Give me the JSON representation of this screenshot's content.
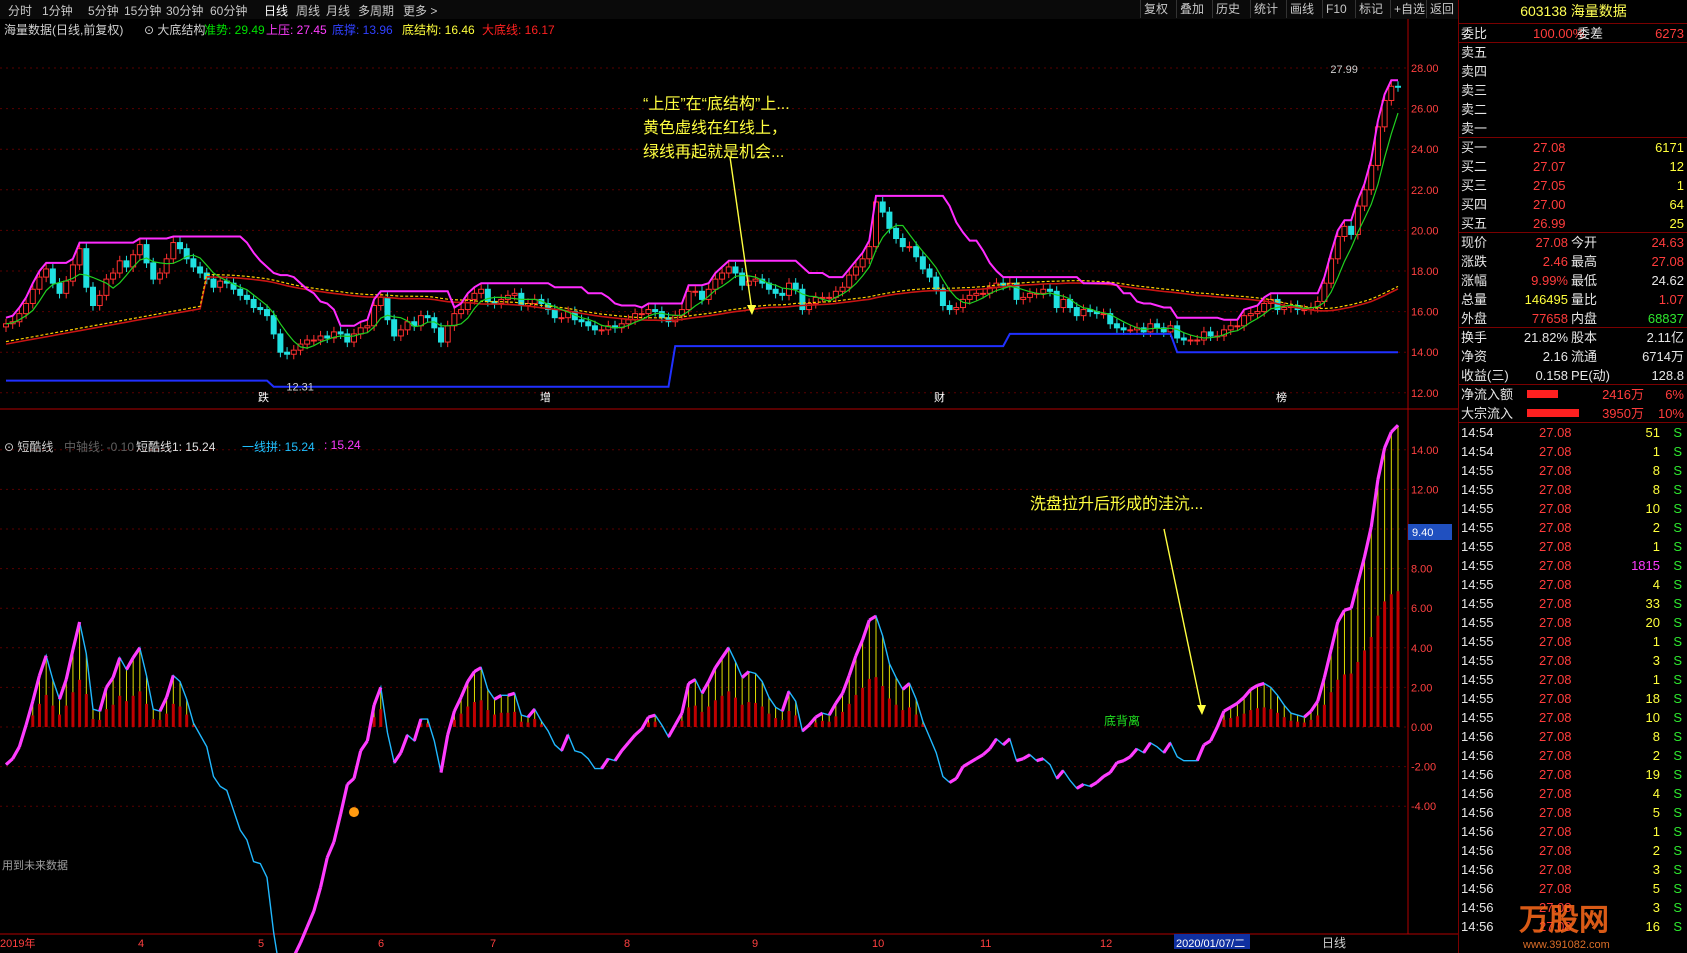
{
  "periods": [
    "分时",
    "1分钟",
    "5分钟",
    "15分钟",
    "30分钟",
    "60分钟",
    "日线",
    "周线",
    "月线",
    "多周期",
    "更多 >"
  ],
  "toolbar": [
    "复权",
    "叠加",
    "历史",
    "统计",
    "画线",
    "F10",
    "标记",
    "+自选",
    "返回"
  ],
  "upper": {
    "stock": "海量数据(日线,前复权)",
    "indicator": "大底结构",
    "vals": [
      {
        "t": "准势: 29.49",
        "c": "#00e000"
      },
      {
        "t": "上压: 27.45",
        "c": "#ff3cff"
      },
      {
        "t": "底撑: 13.96",
        "c": "#3040ff"
      },
      {
        "t": "底结构: 16.46",
        "c": "#ffff3c"
      },
      {
        "t": "大底线: 16.17",
        "c": "#ff2020"
      }
    ],
    "annotation": [
      "“上压”在“底结构”上...",
      "黄色虚线在红线上，",
      "绿线再起就是机会..."
    ],
    "high_label": "27.99",
    "low_label": "12.31",
    "markers": [
      "跌",
      "增",
      "财",
      "榜"
    ],
    "yaxis": [
      "28.00",
      "26.00",
      "24.00",
      "22.00",
      "20.00",
      "18.00",
      "16.00",
      "14.00",
      "12.00"
    ]
  },
  "lower": {
    "indicator": "短酷线",
    "vals": [
      {
        "t": "中轴线: -0.10",
        "c": "#606060"
      },
      {
        "t": "短酷线1: 15.24",
        "c": "#e0e0e0"
      },
      {
        "t": "一线拼: 15.24",
        "c": "#20c0ff"
      },
      {
        "t": ": 15.24",
        "c": "#ff3cff"
      }
    ],
    "annotation": "洗盘拉升后形成的洼沆...",
    "bottom_label": "底背离",
    "cursor_val": "9.40",
    "footnote": "用到未来数据",
    "yaxis": [
      "14.00",
      "12.00",
      "10.00",
      "8.00",
      "6.00",
      "4.00",
      "2.00",
      "0.00",
      "-2.00",
      "-4.00"
    ]
  },
  "xaxis": [
    "2019年",
    "4",
    "5",
    "6",
    "7",
    "8",
    "9",
    "10",
    "11",
    "12",
    "2020/01/07/二"
  ],
  "period_label": "日线",
  "chart_data": {
    "type": "candlestick",
    "title": "海量数据(日线,前复权)",
    "ylim": [
      11.5,
      29.5
    ],
    "close": [
      15.4,
      15.5,
      15.9,
      16.4,
      17.1,
      17.7,
      18.1,
      17.4,
      16.9,
      17.5,
      18.3,
      19.1,
      17.2,
      16.3,
      16.8,
      17.6,
      17.9,
      18.5,
      18.2,
      18.8,
      19.3,
      18.4,
      17.6,
      17.9,
      18.6,
      19.4,
      19.1,
      18.6,
      18.2,
      17.9,
      17.6,
      17.2,
      17.5,
      17.4,
      17.1,
      16.8,
      16.6,
      16.2,
      16.1,
      15.8,
      14.9,
      14.0,
      13.9,
      14.1,
      14.4,
      14.6,
      14.6,
      14.8,
      14.7,
      15.0,
      14.9,
      14.5,
      14.9,
      15.2,
      15.3,
      16.3,
      16.7,
      15.6,
      14.8,
      15.1,
      15.5,
      15.3,
      15.8,
      15.7,
      15.2,
      14.5,
      15.3,
      15.9,
      16.1,
      16.6,
      16.9,
      17.1,
      16.5,
      16.4,
      16.6,
      16.8,
      16.9,
      16.3,
      16.4,
      16.6,
      16.4,
      16.1,
      15.7,
      15.7,
      16.0,
      15.6,
      15.5,
      15.3,
      15.1,
      15.1,
      15.3,
      15.2,
      15.4,
      15.6,
      15.9,
      15.9,
      16.1,
      16.0,
      15.7,
      15.5,
      15.8,
      16.1,
      17.0,
      17.0,
      16.6,
      17.1,
      17.6,
      17.9,
      18.2,
      17.9,
      17.3,
      17.5,
      17.6,
      17.4,
      17.1,
      16.9,
      16.8,
      17.4,
      17.1,
      16.1,
      16.4,
      16.7,
      16.7,
      16.7,
      17.0,
      17.2,
      17.8,
      18.2,
      18.6,
      19.2,
      21.4,
      20.9,
      20.1,
      19.6,
      19.2,
      19.2,
      18.7,
      18.1,
      17.7,
      17.1,
      16.3,
      16.1,
      16.2,
      16.6,
      16.8,
      16.9,
      16.9,
      17.2,
      17.4,
      17.3,
      17.4,
      16.6,
      16.7,
      16.9,
      16.9,
      17.1,
      17.0,
      16.2,
      16.6,
      16.2,
      15.8,
      16.1,
      16.0,
      15.9,
      15.9,
      15.4,
      15.2,
      15.1,
      15.1,
      15.2,
      15.0,
      15.4,
      15.2,
      15.0,
      15.3,
      14.7,
      14.6,
      14.6,
      14.6,
      15.0,
      14.8,
      14.8,
      15.1,
      15.3,
      15.3,
      15.8,
      15.9,
      16.0,
      16.4,
      16.6,
      16.1,
      16.2,
      16.3,
      16.1,
      16.1,
      16.2,
      16.5,
      17.4,
      18.6,
      19.7,
      20.2,
      19.8,
      21.2,
      22.0,
      23.2,
      25.1,
      26.4,
      27.1,
      27.08
    ],
    "lower_values": [
      -1.9,
      -1.6,
      -1.0,
      0.1,
      1.3,
      2.6,
      3.6,
      2.4,
      1.4,
      2.4,
      3.9,
      5.3,
      3.7,
      0.9,
      0.8,
      2.0,
      2.5,
      3.5,
      2.9,
      3.5,
      4.0,
      2.6,
      0.9,
      0.8,
      1.5,
      2.6,
      2.3,
      1.4,
      0.2,
      -0.4,
      -1.0,
      -2.5,
      -3.0,
      -3.2,
      -4.2,
      -5.2,
      -5.7,
      -6.8,
      -6.9,
      -7.6,
      -10.4,
      -12.5,
      -12.9,
      -11.6,
      -10.9,
      -10.1,
      -9.3,
      -8.1,
      -6.6,
      -5.8,
      -4.4,
      -2.9,
      -2.6,
      -1.2,
      -0.7,
      1.1,
      2.0,
      -0.3,
      -1.8,
      -1.3,
      -0.4,
      -0.7,
      0.4,
      0.4,
      -0.7,
      -2.3,
      -0.4,
      0.8,
      1.5,
      2.3,
      2.8,
      3.0,
      1.9,
      1.4,
      1.6,
      1.6,
      1.7,
      0.6,
      0.5,
      0.9,
      0.3,
      -0.2,
      -0.9,
      -1.2,
      -0.4,
      -1.2,
      -1.3,
      -1.6,
      -2.1,
      -2.1,
      -1.6,
      -1.7,
      -1.2,
      -0.8,
      -0.4,
      -0.1,
      0.5,
      0.6,
      0.1,
      -0.5,
      0.1,
      0.7,
      2.2,
      2.4,
      1.7,
      2.3,
      3.0,
      3.5,
      4.0,
      3.3,
      2.5,
      2.8,
      2.7,
      2.3,
      1.5,
      1.0,
      0.8,
      1.8,
      1.3,
      -0.2,
      0.1,
      0.5,
      0.7,
      0.6,
      1.2,
      1.7,
      2.6,
      3.6,
      4.4,
      5.4,
      5.6,
      4.6,
      3.2,
      2.5,
      1.9,
      2.2,
      1.4,
      0.3,
      -0.5,
      -1.3,
      -2.5,
      -2.8,
      -2.6,
      -2.0,
      -1.8,
      -1.6,
      -1.4,
      -1.1,
      -0.6,
      -0.9,
      -0.6,
      -1.7,
      -1.6,
      -1.4,
      -1.7,
      -1.6,
      -1.9,
      -2.6,
      -2.2,
      -2.7,
      -3.1,
      -2.9,
      -3.0,
      -2.8,
      -2.5,
      -2.3,
      -1.8,
      -1.7,
      -1.5,
      -1.1,
      -1.3,
      -0.8,
      -1.0,
      -1.3,
      -0.8,
      -1.5,
      -1.7,
      -1.7,
      -1.7,
      -0.9,
      -0.7,
      0.0,
      0.8,
      1.0,
      1.2,
      1.5,
      1.9,
      2.1,
      2.2,
      2.0,
      1.6,
      1.1,
      0.7,
      0.6,
      0.5,
      0.8,
      1.3,
      2.5,
      3.9,
      5.3,
      5.9,
      6.0,
      7.3,
      8.6,
      10.1,
      12.5,
      14.1,
      14.9,
      15.24
    ]
  },
  "right_panel": {
    "code_name": "603138 海量数据",
    "weibi": {
      "label": "委比",
      "val": "100.00%",
      "label2": "委差",
      "val2": "6273"
    },
    "sell": [
      {
        "l": "卖五",
        "p": "",
        "v": ""
      },
      {
        "l": "卖四",
        "p": "",
        "v": ""
      },
      {
        "l": "卖三",
        "p": "",
        "v": ""
      },
      {
        "l": "卖二",
        "p": "",
        "v": ""
      },
      {
        "l": "卖一",
        "p": "",
        "v": ""
      }
    ],
    "buy": [
      {
        "l": "买一",
        "p": "27.08",
        "v": "6171"
      },
      {
        "l": "买二",
        "p": "27.07",
        "v": "12"
      },
      {
        "l": "买三",
        "p": "27.05",
        "v": "1"
      },
      {
        "l": "买四",
        "p": "27.00",
        "v": "64"
      },
      {
        "l": "买五",
        "p": "26.99",
        "v": "25"
      }
    ],
    "stats": [
      [
        {
          "t": "现价",
          "c": "wht"
        },
        {
          "t": "27.08",
          "c": "red"
        },
        {
          "t": "今开",
          "c": "wht"
        },
        {
          "t": "24.63",
          "c": "red"
        }
      ],
      [
        {
          "t": "涨跌",
          "c": "wht"
        },
        {
          "t": "2.46",
          "c": "red"
        },
        {
          "t": "最高",
          "c": "wht"
        },
        {
          "t": "27.08",
          "c": "red"
        }
      ],
      [
        {
          "t": "涨幅",
          "c": "wht"
        },
        {
          "t": "9.99%",
          "c": "red"
        },
        {
          "t": "最低",
          "c": "wht"
        },
        {
          "t": "24.62",
          "c": "wht"
        }
      ],
      [
        {
          "t": "总量",
          "c": "wht"
        },
        {
          "t": "146495",
          "c": "yel"
        },
        {
          "t": "量比",
          "c": "wht"
        },
        {
          "t": "1.07",
          "c": "red"
        }
      ],
      [
        {
          "t": "外盘",
          "c": "wht"
        },
        {
          "t": "77658",
          "c": "red"
        },
        {
          "t": "内盘",
          "c": "wht"
        },
        {
          "t": "68837",
          "c": "grn"
        }
      ]
    ],
    "fund": [
      [
        {
          "t": "换手",
          "c": "wht"
        },
        {
          "t": "21.82%",
          "c": "wht"
        },
        {
          "t": "股本",
          "c": "wht"
        },
        {
          "t": "2.11亿",
          "c": "wht"
        }
      ],
      [
        {
          "t": "净资",
          "c": "wht"
        },
        {
          "t": "2.16",
          "c": "wht"
        },
        {
          "t": "流通",
          "c": "wht"
        },
        {
          "t": "6714万",
          "c": "wht"
        }
      ],
      [
        {
          "t": "收益(三)",
          "c": "wht"
        },
        {
          "t": "0.158",
          "c": "wht"
        },
        {
          "t": "PE(动)",
          "c": "wht"
        },
        {
          "t": "128.8",
          "c": "wht"
        }
      ]
    ],
    "flows": [
      {
        "l": "净流入额",
        "v": "2416万",
        "p": "6%",
        "frac": 0.6
      },
      {
        "l": "大宗流入",
        "v": "3950万",
        "p": "10%",
        "frac": 1.0
      }
    ],
    "ticks": [
      [
        "14:54",
        "27.08",
        "51",
        "S"
      ],
      [
        "14:54",
        "27.08",
        "1",
        "S"
      ],
      [
        "14:55",
        "27.08",
        "8",
        "S"
      ],
      [
        "14:55",
        "27.08",
        "8",
        "S"
      ],
      [
        "14:55",
        "27.08",
        "10",
        "S"
      ],
      [
        "14:55",
        "27.08",
        "2",
        "S"
      ],
      [
        "14:55",
        "27.08",
        "1",
        "S"
      ],
      [
        "14:55",
        "27.08",
        "1815",
        "S"
      ],
      [
        "14:55",
        "27.08",
        "4",
        "S"
      ],
      [
        "14:55",
        "27.08",
        "33",
        "S"
      ],
      [
        "14:55",
        "27.08",
        "20",
        "S"
      ],
      [
        "14:55",
        "27.08",
        "1",
        "S"
      ],
      [
        "14:55",
        "27.08",
        "3",
        "S"
      ],
      [
        "14:55",
        "27.08",
        "1",
        "S"
      ],
      [
        "14:55",
        "27.08",
        "18",
        "S"
      ],
      [
        "14:55",
        "27.08",
        "10",
        "S"
      ],
      [
        "14:56",
        "27.08",
        "8",
        "S"
      ],
      [
        "14:56",
        "27.08",
        "2",
        "S"
      ],
      [
        "14:56",
        "27.08",
        "19",
        "S"
      ],
      [
        "14:56",
        "27.08",
        "4",
        "S"
      ],
      [
        "14:56",
        "27.08",
        "5",
        "S"
      ],
      [
        "14:56",
        "27.08",
        "1",
        "S"
      ],
      [
        "14:56",
        "27.08",
        "2",
        "S"
      ],
      [
        "14:56",
        "27.08",
        "3",
        "S"
      ],
      [
        "14:56",
        "27.08",
        "5",
        "S"
      ],
      [
        "14:56",
        "27.08",
        "3",
        "S"
      ],
      [
        "14:56",
        "27.08",
        "16",
        "S"
      ]
    ],
    "watermark": "万股网",
    "watermark_url": "www.391082.com"
  }
}
